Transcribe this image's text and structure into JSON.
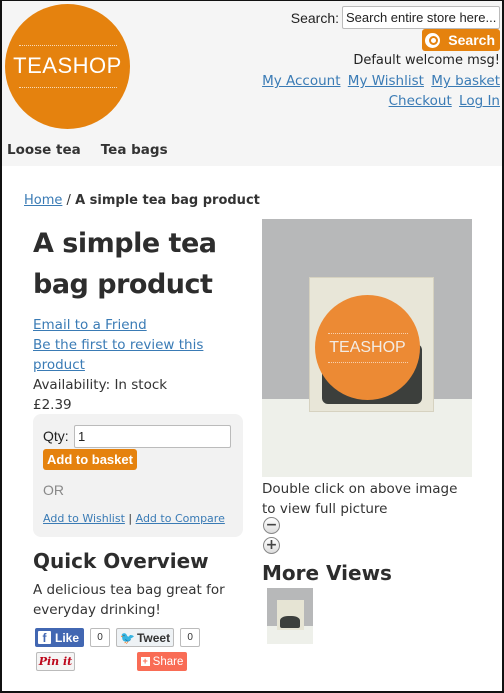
{
  "header": {
    "logo_text": "TEASHOP",
    "search_label": "Search:",
    "search_placeholder": "Search entire store here...",
    "search_button": "Search",
    "welcome": "Default welcome msg!",
    "links_row1": [
      "My Account",
      "My Wishlist",
      "My basket"
    ],
    "links_row2": [
      "Checkout",
      "Log In"
    ]
  },
  "nav": {
    "items": [
      "Loose tea",
      "Tea bags"
    ]
  },
  "breadcrumb": {
    "home": "Home",
    "separator": "/",
    "current": "A simple tea bag product"
  },
  "product": {
    "title": "A simple tea bag product",
    "email_friend": "Email to a Friend",
    "review_link": "Be the first to review this product",
    "availability": "Availability: In stock",
    "price": "£2.39",
    "qty_label": "Qty:",
    "qty_value": "1",
    "add_to_basket": "Add to basket",
    "or": "OR",
    "add_to_wishlist": "Add to Wishlist",
    "wish_separator": "|",
    "add_to_compare": "Add to Compare",
    "image_label": "TEASHOP",
    "image_note": "Double click on above image to view full picture",
    "zoom_out": "−",
    "zoom_in": "+",
    "more_views": "More Views"
  },
  "overview": {
    "title": "Quick Overview",
    "text": "A delicious tea bag great for everyday drinking!"
  },
  "social": {
    "like_label": "Like",
    "like_count": "0",
    "tweet_label": "Tweet",
    "tweet_count": "0",
    "pin_label": "Pin it",
    "share_label": "Share"
  },
  "colors": {
    "brand_orange": "#e5820e",
    "link_blue": "#3a7bb5",
    "facebook_blue": "#4267b2",
    "share_red": "#f96c55"
  }
}
